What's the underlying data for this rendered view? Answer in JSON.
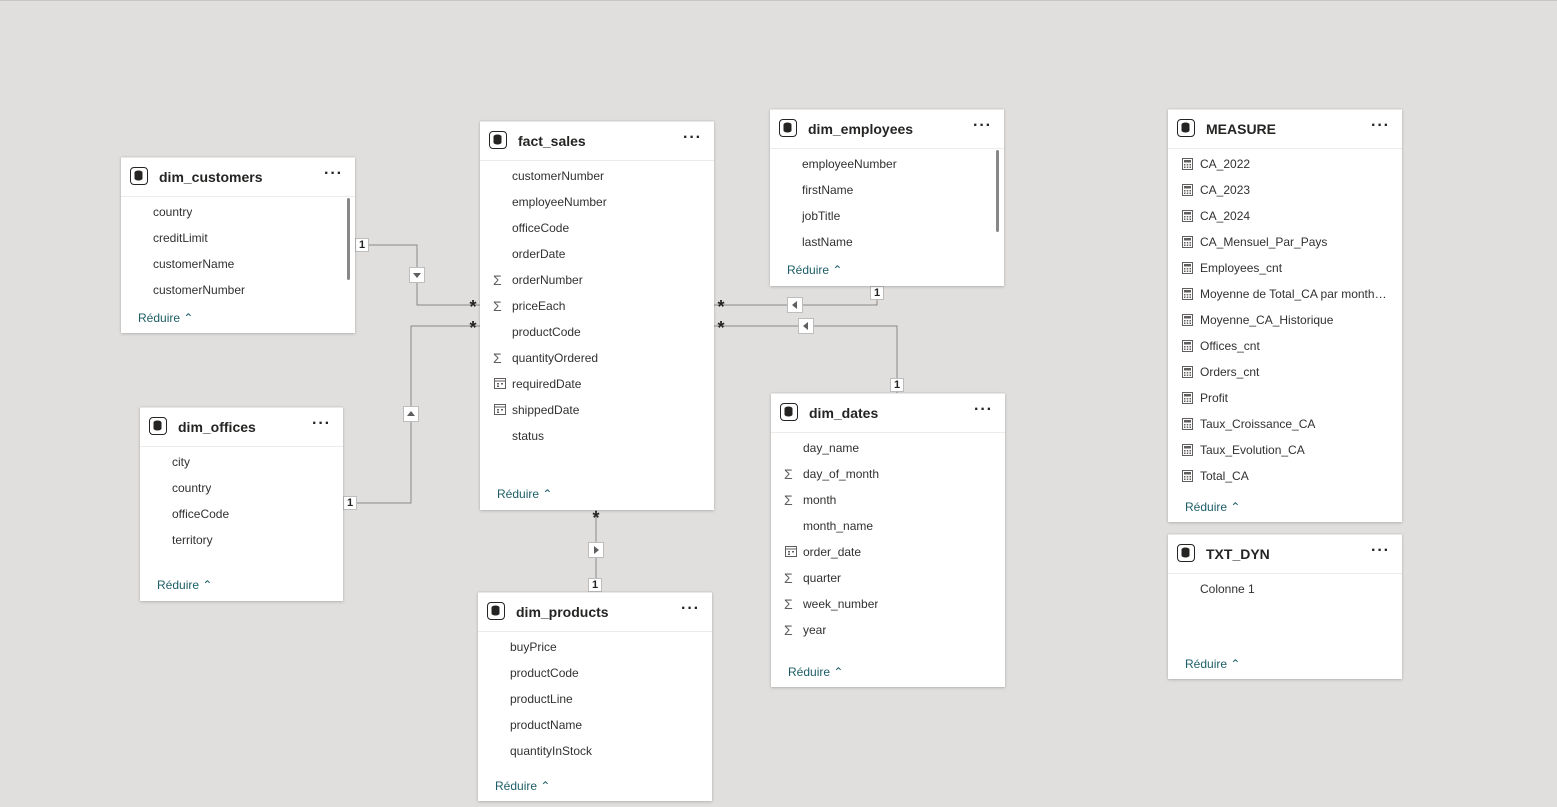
{
  "colors": {
    "canvas": "#e1dfdd",
    "card": "#ffffff",
    "link": "#1c5d67",
    "line": "#8a8886"
  },
  "icons": {
    "table": "database-icon",
    "sum": "sigma-icon",
    "calendar": "calendar-icon",
    "measure": "calculator-icon",
    "more": "more-icon",
    "collapse": "chevron-up-icon"
  },
  "tables": {
    "dim_customers": {
      "title": "dim_customers",
      "more": "···",
      "reduce": "Réduire",
      "fields": [
        "country",
        "creditLimit",
        "customerName",
        "customerNumber"
      ]
    },
    "fact_sales": {
      "title": "fact_sales",
      "more": "···",
      "reduce": "Réduire",
      "fields": [
        "customerNumber",
        "employeeNumber",
        "officeCode",
        "orderDate",
        "orderNumber",
        "priceEach",
        "productCode",
        "quantityOrdered",
        "requiredDate",
        "shippedDate",
        "status"
      ]
    },
    "dim_employees": {
      "title": "dim_employees",
      "more": "···",
      "reduce": "Réduire",
      "fields": [
        "employeeNumber",
        "firstName",
        "jobTitle",
        "lastName"
      ]
    },
    "measure": {
      "title": "MEASURE",
      "more": "···",
      "reduce": "Réduire",
      "fields": [
        "CA_2022",
        "CA_2023",
        "CA_2024",
        "CA_Mensuel_Par_Pays",
        "Employees_cnt",
        "Moyenne de Total_CA par month_...",
        "Moyenne_CA_Historique",
        "Offices_cnt",
        "Orders_cnt",
        "Profit",
        "Taux_Croissance_CA",
        "Taux_Evolution_CA",
        "Total_CA"
      ]
    },
    "dim_offices": {
      "title": "dim_offices",
      "more": "···",
      "reduce": "Réduire",
      "fields": [
        "city",
        "country",
        "officeCode",
        "territory"
      ]
    },
    "dim_dates": {
      "title": "dim_dates",
      "more": "···",
      "reduce": "Réduire",
      "fields": [
        "day_name",
        "day_of_month",
        "month",
        "month_name",
        "order_date",
        "quarter",
        "week_number",
        "year"
      ]
    },
    "dim_products": {
      "title": "dim_products",
      "more": "···",
      "reduce": "Réduire",
      "fields": [
        "buyPrice",
        "productCode",
        "productLine",
        "productName",
        "quantityInStock"
      ]
    },
    "txt_dyn": {
      "title": "TXT_DYN",
      "more": "···",
      "reduce": "Réduire",
      "fields": [
        "Colonne 1"
      ]
    }
  },
  "relationships": {
    "one": "1",
    "many": "*"
  }
}
